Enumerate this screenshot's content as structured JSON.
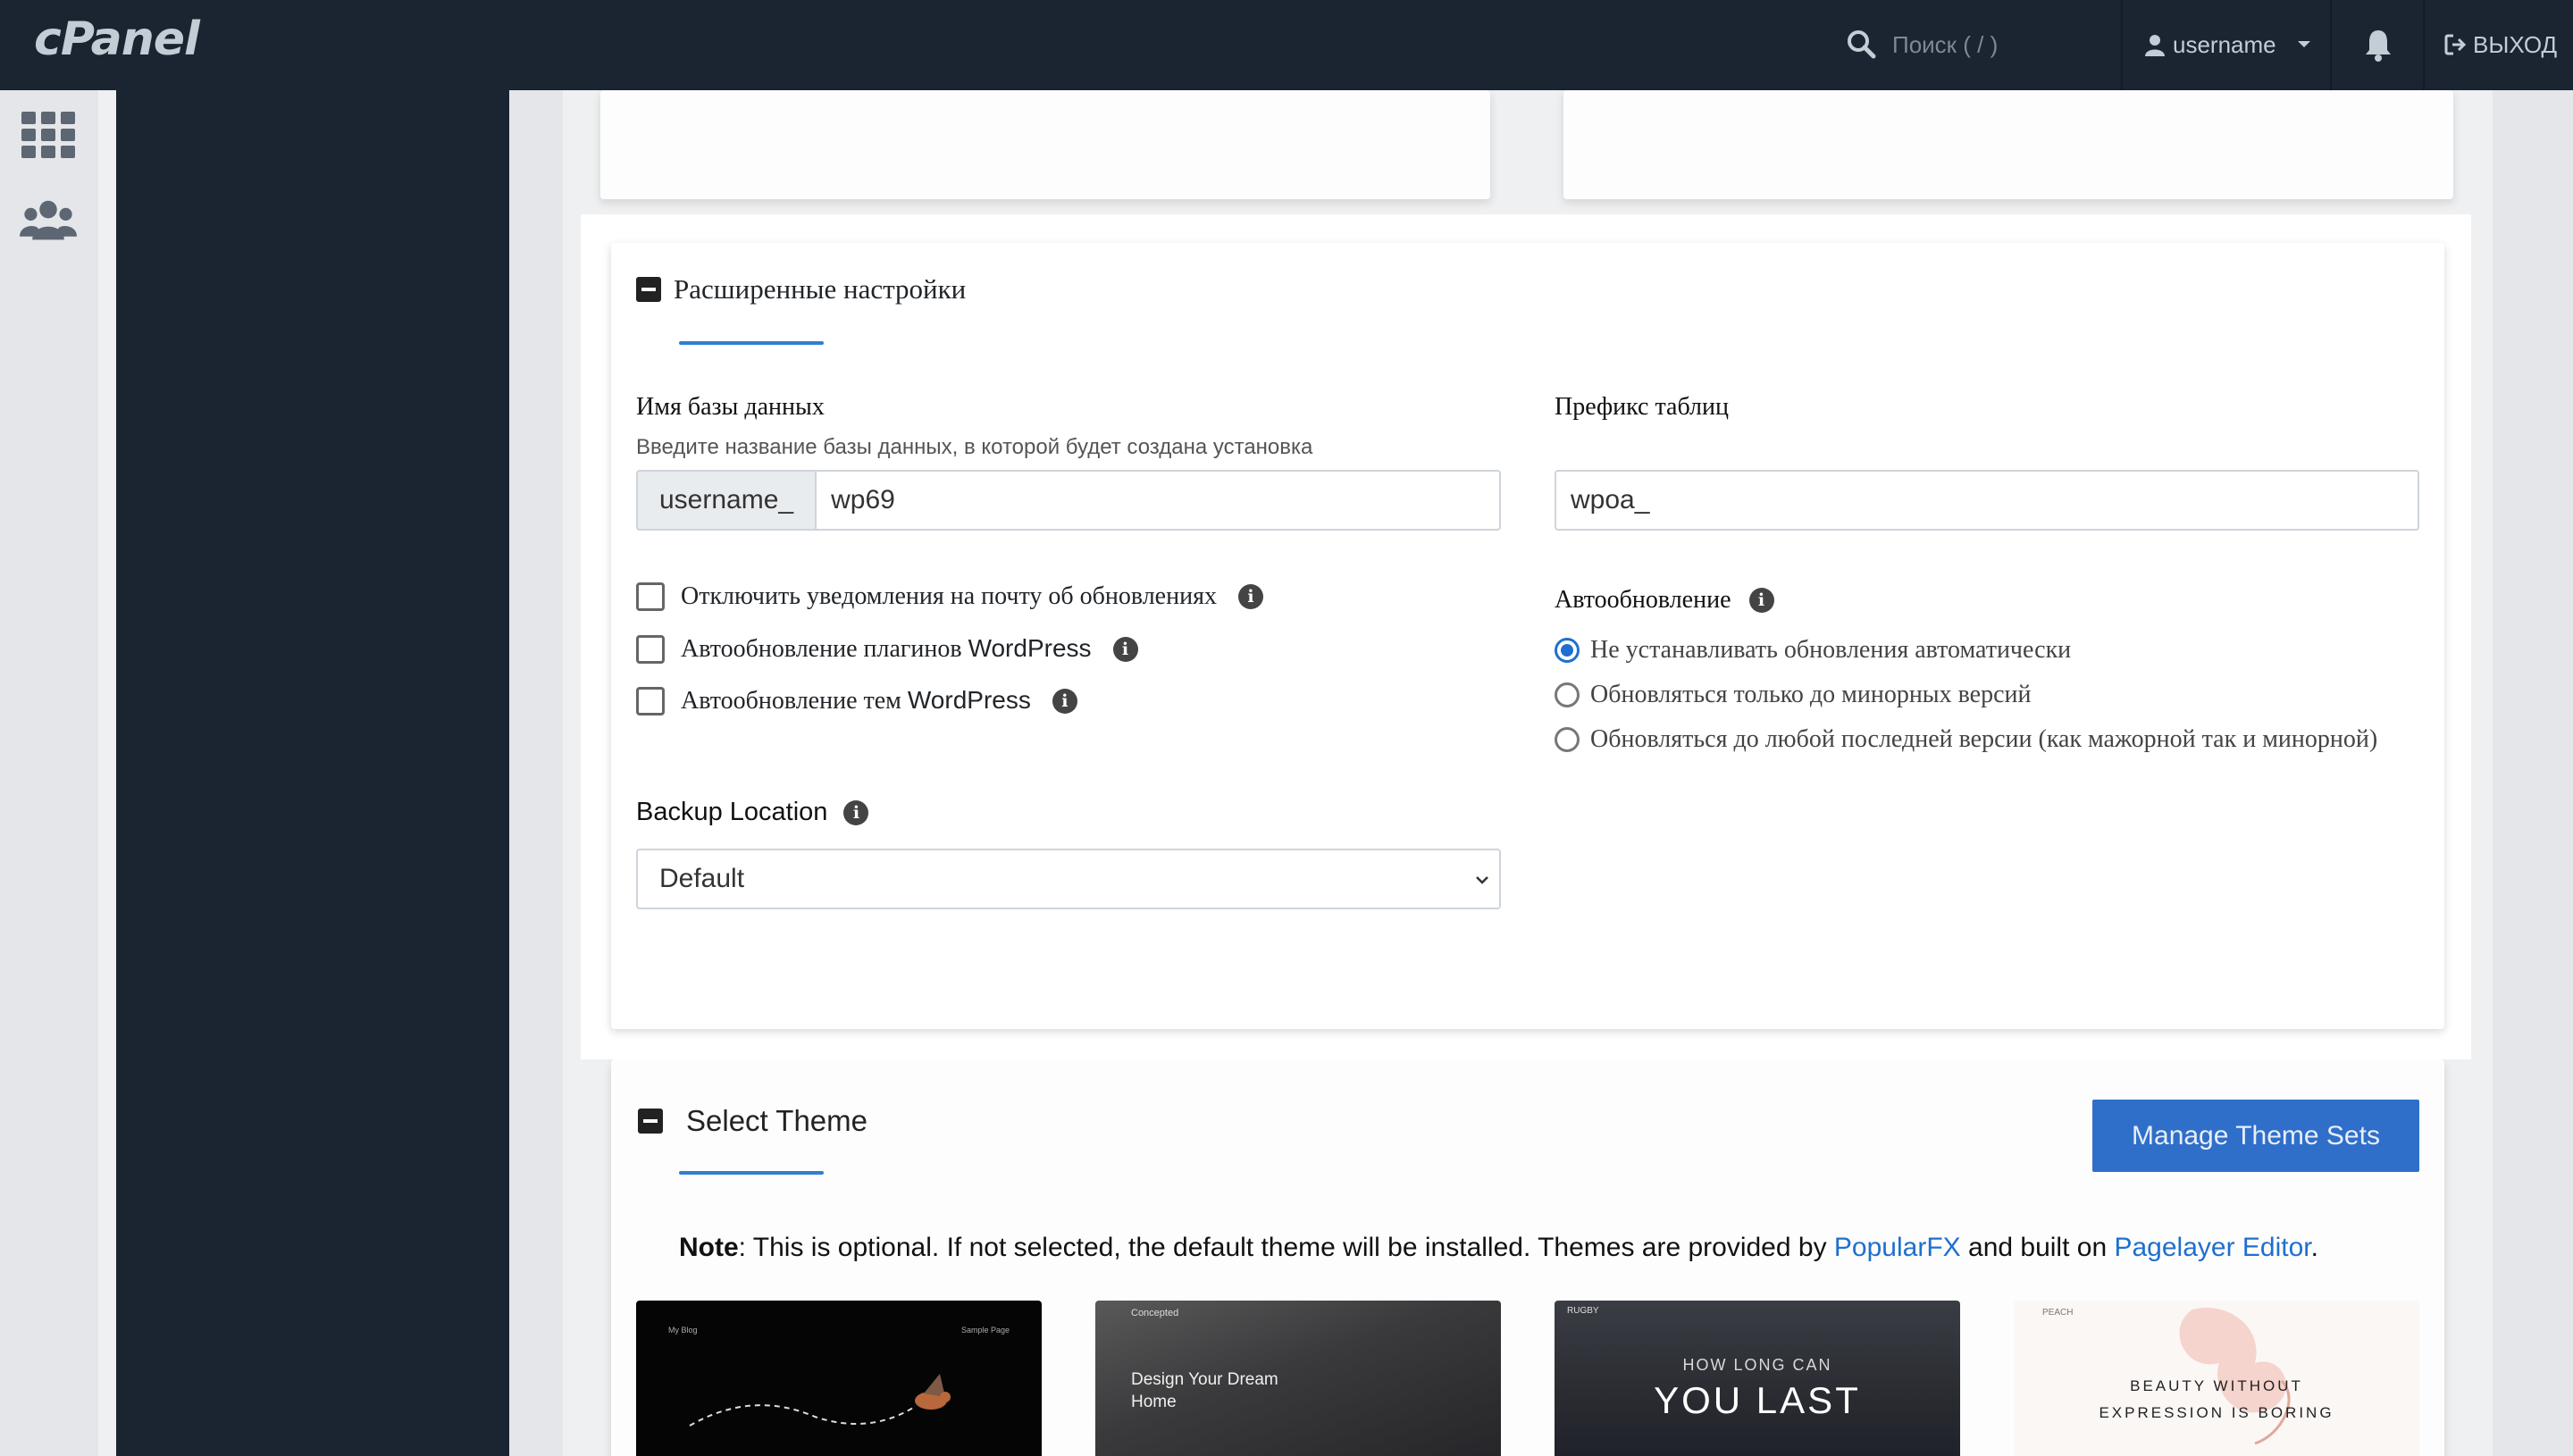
{
  "header": {
    "logo": "cPanel",
    "search_placeholder": "Поиск ( / )",
    "username": "username",
    "logout_label": "ВЫХОД"
  },
  "advanced": {
    "title": "Расширенные настройки",
    "db_name_label": "Имя базы данных",
    "db_name_hint": "Введите название базы данных, в которой будет создана установка",
    "db_prefix": "username_",
    "db_name_value": "wp69",
    "table_prefix_label": "Префикс таблиц",
    "table_prefix_value": "wpoa_",
    "checkboxes": [
      {
        "label": "Отключить уведомления на почту об обновлениях",
        "checked": false
      },
      {
        "label_ru": "Автообновление плагинов",
        "label_brand": "WordPress",
        "checked": false
      },
      {
        "label_ru": "Автообновление тем",
        "label_brand": "WordPress",
        "checked": false
      }
    ],
    "autoupdate_label": "Автообновление",
    "autoupdate_options": [
      {
        "label": "Не устанавливать обновления автоматически",
        "selected": true
      },
      {
        "label": "Обновляться только до минорных версий",
        "selected": false
      },
      {
        "label": "Обновляться до любой последней версии (как мажорной так и минорной)",
        "selected": false
      }
    ],
    "backup_label": "Backup Location",
    "backup_value": "Default"
  },
  "theme": {
    "title": "Select Theme",
    "manage_button": "Manage Theme Sets",
    "note_bold": "Note",
    "note_text": ": This is optional. If not selected, the default theme will be installed. Themes are provided by ",
    "note_link1": "PopularFX",
    "note_mid": " and built on ",
    "note_link2": "Pagelayer Editor",
    "note_end": ".",
    "thumbs": [
      {
        "top_left": "My Blog",
        "top_right": "Sample Page"
      },
      {
        "brand": "Concepted",
        "headline": "Design Your Dream Home"
      },
      {
        "brand": "RUGBY",
        "line1": "HOW LONG CAN",
        "line2": "YOU LAST"
      },
      {
        "brand": "PEACH",
        "line1": "BEAUTY WITHOUT",
        "line2": "EXPRESSION IS BORING"
      }
    ]
  }
}
